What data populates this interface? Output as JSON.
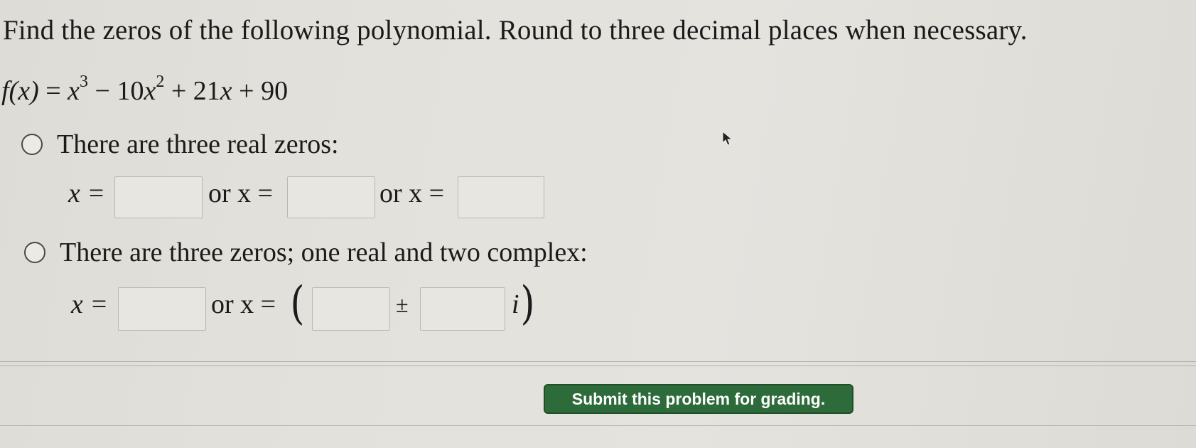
{
  "prompt": "Find the zeros of the following polynomial. Round to three decimal places when necessary.",
  "polynomial": {
    "lhs": "f(x)",
    "eq": " = ",
    "term1_base": "x",
    "term1_exp": "3",
    "op1": " − 10",
    "term2_base": "x",
    "term2_exp": "2",
    "op2": " + 21",
    "term3_base": "x",
    "op3": " + 90"
  },
  "option_real": {
    "label": "There are three real zeros:",
    "x_eq_1": "x =",
    "or_x_eq_2": "or x =",
    "or_x_eq_3": "or x =",
    "fields": [
      "",
      "",
      ""
    ]
  },
  "option_complex": {
    "label": "There are three zeros; one real and two complex:",
    "x_eq_1": "x =",
    "or_x_eq_2": "or x =",
    "open_paren": "(",
    "plus_minus": "±",
    "imag_unit": "i",
    "close_paren": ")",
    "fields": [
      "",
      "",
      ""
    ]
  },
  "submit_label": "Submit this problem for grading.",
  "colors": {
    "submit_bg": "#2e6b3a",
    "background": "#e2e0da"
  }
}
